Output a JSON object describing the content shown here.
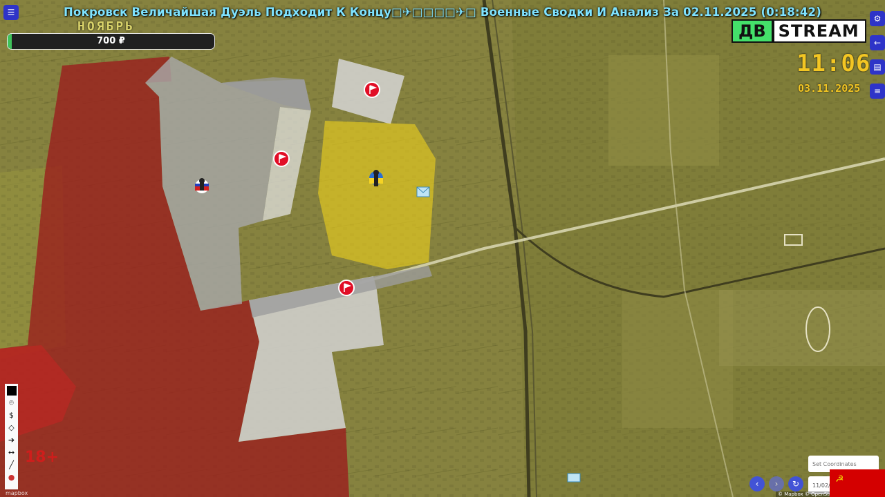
{
  "stream": {
    "title": "Покровск Величайшая Дуэль Подходит К Концу□✈□□□□✈□ Военные Сводки И Анализ За 02.11.2025 (0:18:42)",
    "month_label": "НОЯБРЬ",
    "donation_amount": "700 ₽",
    "donation_progress": 0.02,
    "logo_left": "ДВ",
    "logo_right": "STREAM",
    "clock_time": "11:06",
    "clock_date": "03.11.2025",
    "age_rating": "18+"
  },
  "map": {
    "attribution_mapbox": "mapbox",
    "attribution_right": "© Mapbox © OpenStreetMap",
    "set_coordinates_label": "Set Coordinates",
    "date_input_value": "11/02/",
    "zones": [
      {
        "name": "russian-controlled-zone",
        "color": "#9b1c1c"
      },
      {
        "name": "contested-grey-zone",
        "color": "#bdbdbd"
      },
      {
        "name": "ukrainian-controlled-zone",
        "color": "#c8c227"
      },
      {
        "name": "ukrainian-garrison-zone",
        "color": "#f0d21c"
      }
    ],
    "markers": [
      {
        "name": "red-flag-marker-north",
        "icon": "red-flag-icon"
      },
      {
        "name": "red-flag-marker-west",
        "icon": "red-flag-icon"
      },
      {
        "name": "red-flag-marker-south",
        "icon": "red-flag-icon"
      },
      {
        "name": "russian-soldier-marker",
        "icon": "soldier-russia-icon"
      },
      {
        "name": "ukrainian-soldier-marker",
        "icon": "soldier-ukraine-icon"
      },
      {
        "name": "supply-marker",
        "icon": "envelope-icon"
      }
    ]
  },
  "tools": [
    "color-swatch-icon",
    "marker-pin-icon",
    "dollar-icon",
    "polygon-icon",
    "arrow-icon",
    "measure-icon",
    "line-icon",
    "pin-icon"
  ],
  "right_panel": [
    "gear-icon",
    "arrow-left-icon",
    "book-icon",
    "list-icon"
  ]
}
